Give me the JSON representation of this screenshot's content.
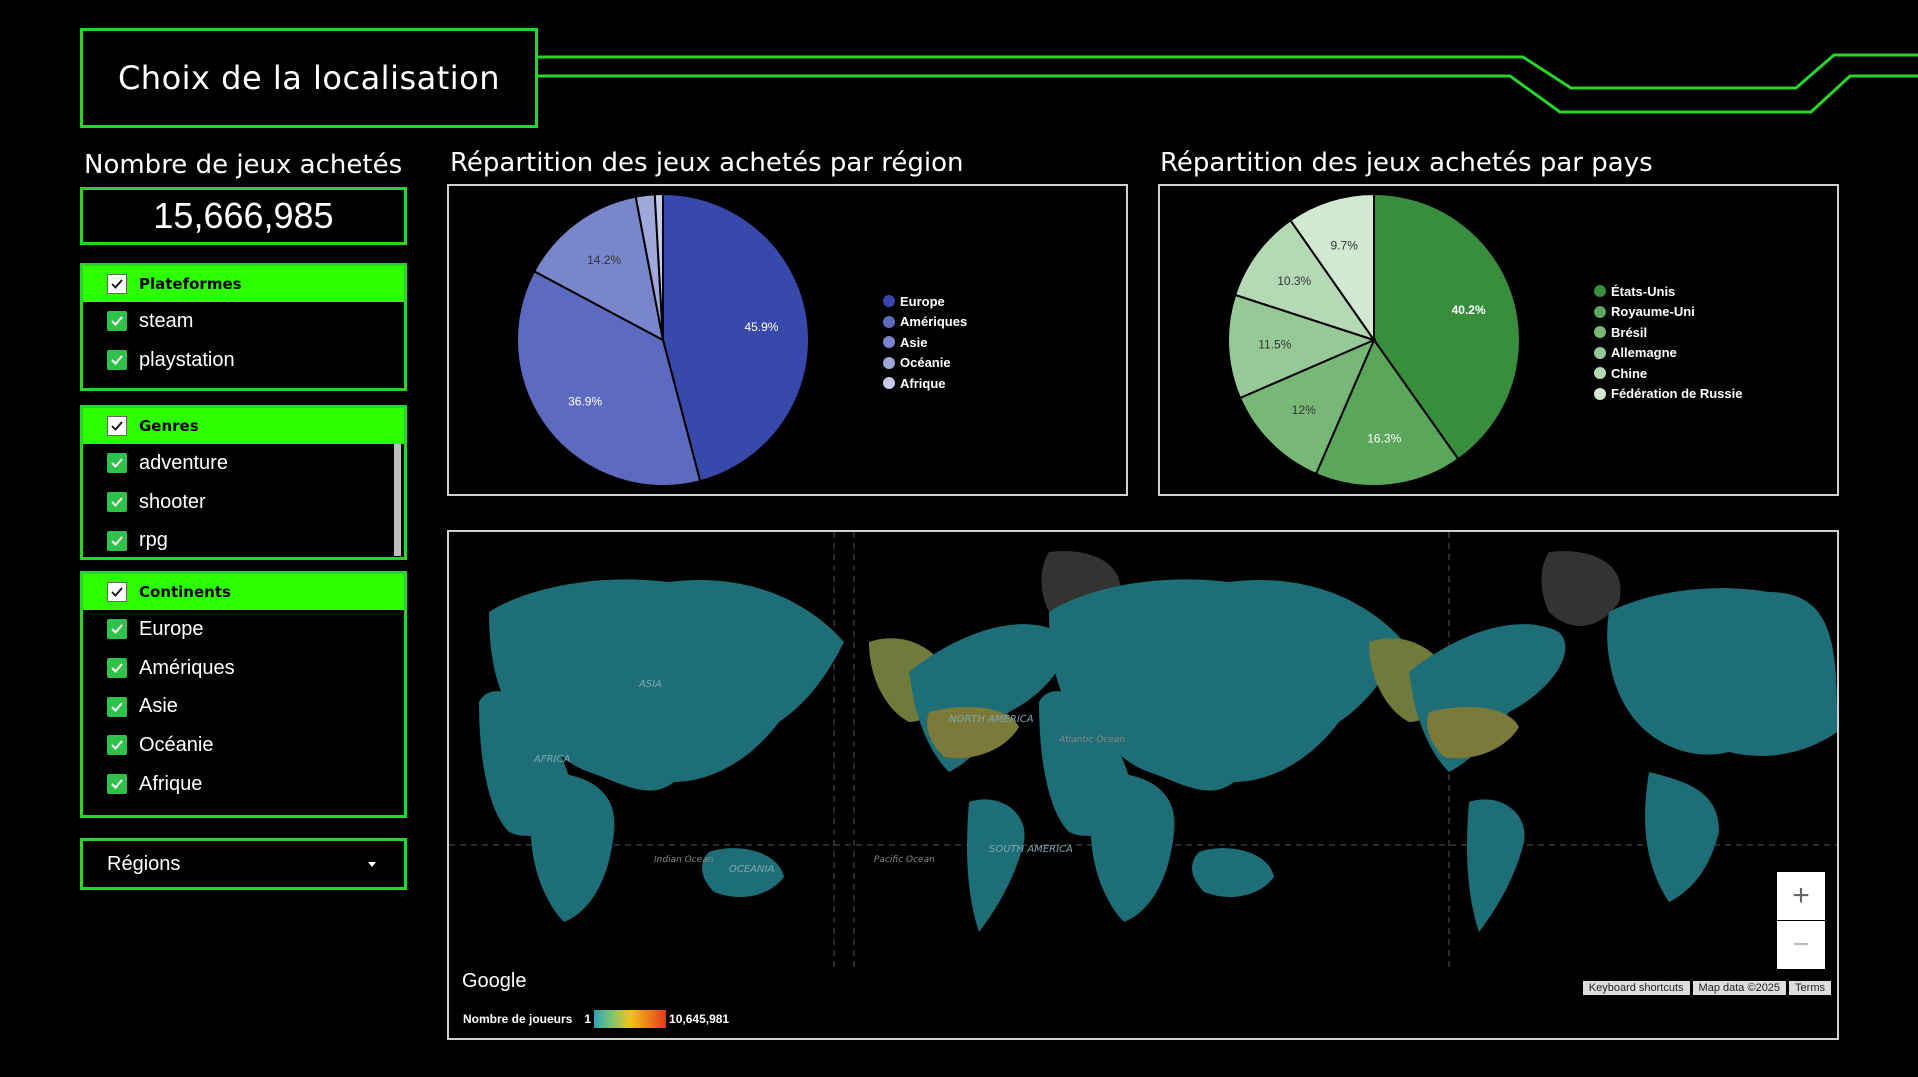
{
  "page_title": "Choix de la localisation",
  "kpi": {
    "label": "Nombre de jeux achetés",
    "value": "15,666,985"
  },
  "filters": {
    "plateformes": {
      "label": "Plateformes",
      "options": [
        "steam",
        "playstation"
      ]
    },
    "genres": {
      "label": "Genres",
      "options": [
        "adventure",
        "shooter",
        "rpg"
      ]
    },
    "continents": {
      "label": "Continents",
      "options": [
        "Europe",
        "Amériques",
        "Asie",
        "Océanie",
        "Afrique"
      ]
    }
  },
  "regions_dropdown": {
    "label": "Régions"
  },
  "chart_data": [
    {
      "type": "pie",
      "title": "Répartition des jeux achetés par région",
      "categories": [
        "Europe",
        "Amériques",
        "Asie",
        "Océanie",
        "Afrique"
      ],
      "values": [
        45.9,
        36.9,
        14.2,
        2.1,
        0.9
      ],
      "slice_labels": [
        "45.9%",
        "36.9%",
        "14.2%",
        "",
        ""
      ],
      "colors": [
        "#3949ab",
        "#5c6bc0",
        "#7986cb",
        "#9fa8da",
        "#c5cae9"
      ],
      "legend_position": "right"
    },
    {
      "type": "pie",
      "title": "Répartition des jeux achetés par pays",
      "categories": [
        "États-Unis",
        "Royaume-Uni",
        "Brésil",
        "Allemagne",
        "Chine",
        "Fédération de Russie"
      ],
      "values": [
        40.2,
        16.3,
        12,
        11.5,
        10.3,
        9.7
      ],
      "slice_labels": [
        "40.2%",
        "16.3%",
        "12%",
        "11.5%",
        "10.3%",
        "9.7%"
      ],
      "colors": [
        "#388e3c",
        "#5aa65b",
        "#77b877",
        "#97c997",
        "#b5d9b5",
        "#d1e8d1"
      ],
      "legend_position": "right"
    }
  ],
  "map": {
    "continent_labels": [
      "ASIA",
      "NORTH AMERICA",
      "SOUTH AMERICA",
      "AFRICA",
      "OCEANIA",
      "Atlantic Ocean",
      "Indian Ocean",
      "Pacific Ocean"
    ],
    "google_label": "Google",
    "attribution": [
      "Keyboard shortcuts",
      "Map data ©2025",
      "Terms"
    ],
    "zoom_in": "+",
    "zoom_out": "−",
    "legend": {
      "title": "Nombre de joueurs",
      "min": "1",
      "max": "10,645,981"
    }
  },
  "colors": {
    "accent_green": "#2eff00",
    "frame_green": "#2bd42b",
    "land": "#1e6e78",
    "highlight": "#6e7b3a"
  }
}
